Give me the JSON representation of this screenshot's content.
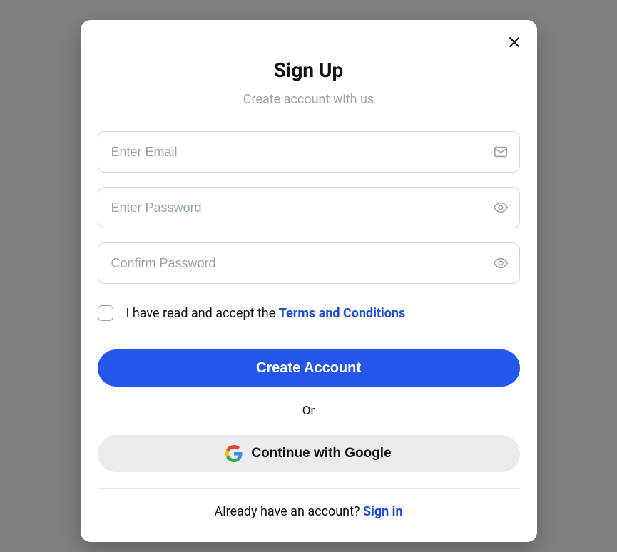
{
  "header": {
    "title": "Sign Up",
    "subtitle": "Create account with us"
  },
  "form": {
    "email_placeholder": "Enter Email",
    "password_placeholder": "Enter Password",
    "confirm_placeholder": "Confirm Password"
  },
  "terms": {
    "prefix": "I have read and accept the ",
    "link": "Terms and Conditions"
  },
  "buttons": {
    "submit": "Create Account",
    "google": "Continue with Google"
  },
  "divider": {
    "or": "Or"
  },
  "signin": {
    "prefix": "Already have an account? ",
    "link": "Sign in"
  }
}
